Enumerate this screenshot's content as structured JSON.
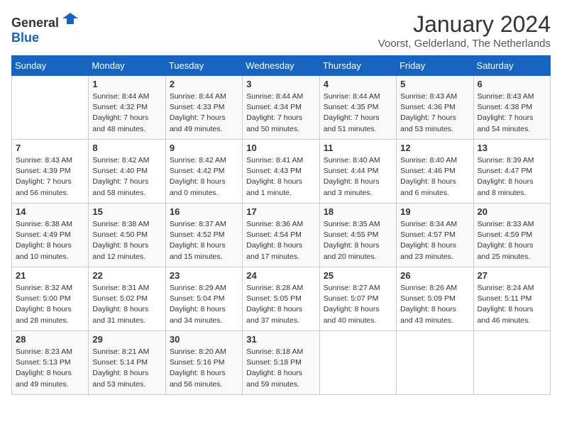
{
  "header": {
    "logo_general": "General",
    "logo_blue": "Blue",
    "month_year": "January 2024",
    "location": "Voorst, Gelderland, The Netherlands"
  },
  "days_of_week": [
    "Sunday",
    "Monday",
    "Tuesday",
    "Wednesday",
    "Thursday",
    "Friday",
    "Saturday"
  ],
  "weeks": [
    [
      {
        "day": "",
        "sunrise": "",
        "sunset": "",
        "daylight": ""
      },
      {
        "day": "1",
        "sunrise": "Sunrise: 8:44 AM",
        "sunset": "Sunset: 4:32 PM",
        "daylight": "Daylight: 7 hours and 48 minutes."
      },
      {
        "day": "2",
        "sunrise": "Sunrise: 8:44 AM",
        "sunset": "Sunset: 4:33 PM",
        "daylight": "Daylight: 7 hours and 49 minutes."
      },
      {
        "day": "3",
        "sunrise": "Sunrise: 8:44 AM",
        "sunset": "Sunset: 4:34 PM",
        "daylight": "Daylight: 7 hours and 50 minutes."
      },
      {
        "day": "4",
        "sunrise": "Sunrise: 8:44 AM",
        "sunset": "Sunset: 4:35 PM",
        "daylight": "Daylight: 7 hours and 51 minutes."
      },
      {
        "day": "5",
        "sunrise": "Sunrise: 8:43 AM",
        "sunset": "Sunset: 4:36 PM",
        "daylight": "Daylight: 7 hours and 53 minutes."
      },
      {
        "day": "6",
        "sunrise": "Sunrise: 8:43 AM",
        "sunset": "Sunset: 4:38 PM",
        "daylight": "Daylight: 7 hours and 54 minutes."
      }
    ],
    [
      {
        "day": "7",
        "sunrise": "Sunrise: 8:43 AM",
        "sunset": "Sunset: 4:39 PM",
        "daylight": "Daylight: 7 hours and 56 minutes."
      },
      {
        "day": "8",
        "sunrise": "Sunrise: 8:42 AM",
        "sunset": "Sunset: 4:40 PM",
        "daylight": "Daylight: 7 hours and 58 minutes."
      },
      {
        "day": "9",
        "sunrise": "Sunrise: 8:42 AM",
        "sunset": "Sunset: 4:42 PM",
        "daylight": "Daylight: 8 hours and 0 minutes."
      },
      {
        "day": "10",
        "sunrise": "Sunrise: 8:41 AM",
        "sunset": "Sunset: 4:43 PM",
        "daylight": "Daylight: 8 hours and 1 minute."
      },
      {
        "day": "11",
        "sunrise": "Sunrise: 8:40 AM",
        "sunset": "Sunset: 4:44 PM",
        "daylight": "Daylight: 8 hours and 3 minutes."
      },
      {
        "day": "12",
        "sunrise": "Sunrise: 8:40 AM",
        "sunset": "Sunset: 4:46 PM",
        "daylight": "Daylight: 8 hours and 6 minutes."
      },
      {
        "day": "13",
        "sunrise": "Sunrise: 8:39 AM",
        "sunset": "Sunset: 4:47 PM",
        "daylight": "Daylight: 8 hours and 8 minutes."
      }
    ],
    [
      {
        "day": "14",
        "sunrise": "Sunrise: 8:38 AM",
        "sunset": "Sunset: 4:49 PM",
        "daylight": "Daylight: 8 hours and 10 minutes."
      },
      {
        "day": "15",
        "sunrise": "Sunrise: 8:38 AM",
        "sunset": "Sunset: 4:50 PM",
        "daylight": "Daylight: 8 hours and 12 minutes."
      },
      {
        "day": "16",
        "sunrise": "Sunrise: 8:37 AM",
        "sunset": "Sunset: 4:52 PM",
        "daylight": "Daylight: 8 hours and 15 minutes."
      },
      {
        "day": "17",
        "sunrise": "Sunrise: 8:36 AM",
        "sunset": "Sunset: 4:54 PM",
        "daylight": "Daylight: 8 hours and 17 minutes."
      },
      {
        "day": "18",
        "sunrise": "Sunrise: 8:35 AM",
        "sunset": "Sunset: 4:55 PM",
        "daylight": "Daylight: 8 hours and 20 minutes."
      },
      {
        "day": "19",
        "sunrise": "Sunrise: 8:34 AM",
        "sunset": "Sunset: 4:57 PM",
        "daylight": "Daylight: 8 hours and 23 minutes."
      },
      {
        "day": "20",
        "sunrise": "Sunrise: 8:33 AM",
        "sunset": "Sunset: 4:59 PM",
        "daylight": "Daylight: 8 hours and 25 minutes."
      }
    ],
    [
      {
        "day": "21",
        "sunrise": "Sunrise: 8:32 AM",
        "sunset": "Sunset: 5:00 PM",
        "daylight": "Daylight: 8 hours and 28 minutes."
      },
      {
        "day": "22",
        "sunrise": "Sunrise: 8:31 AM",
        "sunset": "Sunset: 5:02 PM",
        "daylight": "Daylight: 8 hours and 31 minutes."
      },
      {
        "day": "23",
        "sunrise": "Sunrise: 8:29 AM",
        "sunset": "Sunset: 5:04 PM",
        "daylight": "Daylight: 8 hours and 34 minutes."
      },
      {
        "day": "24",
        "sunrise": "Sunrise: 8:28 AM",
        "sunset": "Sunset: 5:05 PM",
        "daylight": "Daylight: 8 hours and 37 minutes."
      },
      {
        "day": "25",
        "sunrise": "Sunrise: 8:27 AM",
        "sunset": "Sunset: 5:07 PM",
        "daylight": "Daylight: 8 hours and 40 minutes."
      },
      {
        "day": "26",
        "sunrise": "Sunrise: 8:26 AM",
        "sunset": "Sunset: 5:09 PM",
        "daylight": "Daylight: 8 hours and 43 minutes."
      },
      {
        "day": "27",
        "sunrise": "Sunrise: 8:24 AM",
        "sunset": "Sunset: 5:11 PM",
        "daylight": "Daylight: 8 hours and 46 minutes."
      }
    ],
    [
      {
        "day": "28",
        "sunrise": "Sunrise: 8:23 AM",
        "sunset": "Sunset: 5:13 PM",
        "daylight": "Daylight: 8 hours and 49 minutes."
      },
      {
        "day": "29",
        "sunrise": "Sunrise: 8:21 AM",
        "sunset": "Sunset: 5:14 PM",
        "daylight": "Daylight: 8 hours and 53 minutes."
      },
      {
        "day": "30",
        "sunrise": "Sunrise: 8:20 AM",
        "sunset": "Sunset: 5:16 PM",
        "daylight": "Daylight: 8 hours and 56 minutes."
      },
      {
        "day": "31",
        "sunrise": "Sunrise: 8:18 AM",
        "sunset": "Sunset: 5:18 PM",
        "daylight": "Daylight: 8 hours and 59 minutes."
      },
      {
        "day": "",
        "sunrise": "",
        "sunset": "",
        "daylight": ""
      },
      {
        "day": "",
        "sunrise": "",
        "sunset": "",
        "daylight": ""
      },
      {
        "day": "",
        "sunrise": "",
        "sunset": "",
        "daylight": ""
      }
    ]
  ]
}
